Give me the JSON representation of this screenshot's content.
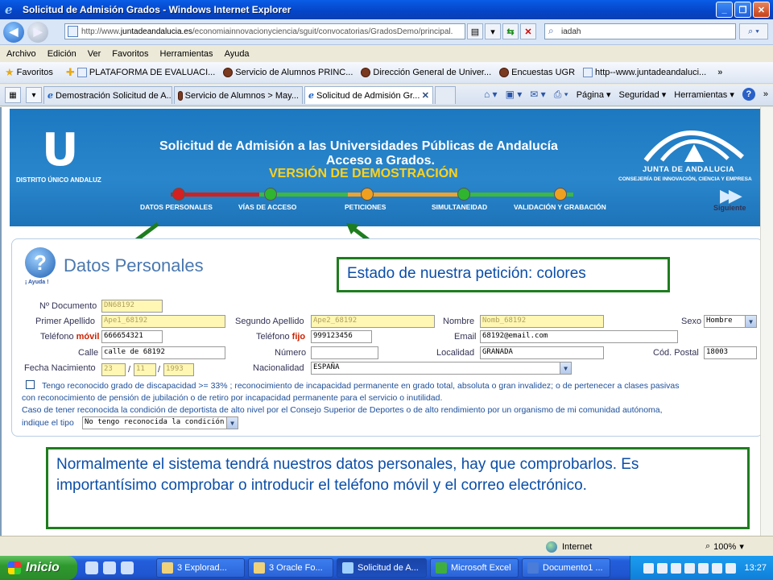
{
  "window": {
    "title": "Solicitud de Admisión Grados - Windows Internet Explorer",
    "minimize": "_",
    "maximize": "❐",
    "close": "✕"
  },
  "address": {
    "url_prefix": "http://www.",
    "url_domain": "juntadeandalucia.es",
    "url_rest": "/economiainnovacionyciencia/sguit/convocatorias/GradosDemo/principal.",
    "search_value": "iadah"
  },
  "menu": [
    "Archivo",
    "Edición",
    "Ver",
    "Favoritos",
    "Herramientas",
    "Ayuda"
  ],
  "favorites": {
    "label": "Favoritos",
    "items": [
      "PLATAFORMA DE EVALUACI...",
      "Servicio de Alumnos PRINC...",
      "Dirección General de Univer...",
      "Encuestas UGR",
      "http--www.juntadeandaluci..."
    ],
    "more": "»"
  },
  "tabs": [
    {
      "label": "Demostración Solicitud de A..."
    },
    {
      "label": "Servicio de Alumnos > May..."
    },
    {
      "label": "Solicitud de Admisión Gr...",
      "active": true
    }
  ],
  "commands": {
    "page": "Página",
    "security": "Seguridad",
    "tools": "Herramientas",
    "more": "»"
  },
  "banner": {
    "logo_letter": "U",
    "logo_text": "DISTRITO ÚNICO ANDALUZ",
    "title_line1": "Solicitud de Admisión a las Universidades Públicas de Andalucía",
    "title_line2": "Acceso a Grados.",
    "title_line3": "VERSIÓN DE DEMOSTRACIÓN",
    "steps": [
      {
        "label": "DATOS PERSONALES",
        "color": "#d42020"
      },
      {
        "label": "VÍAS DE ACCESO",
        "color": "#2fb52f"
      },
      {
        "label": "PETICIONES",
        "color": "#f0a020"
      },
      {
        "label": "SIMULTANEIDAD",
        "color": "#2fb52f"
      },
      {
        "label": "VALIDACIÓN Y GRABACIÓN",
        "color": "#f0a020"
      }
    ],
    "junta_name": "JUNTA DE ANDALUCIA",
    "junta_sub": "CONSEJERÍA DE INNOVACIÓN, CIENCIA Y EMPRESA",
    "next": "Siguiente"
  },
  "form": {
    "title": "Datos Personales",
    "help": "¡ Ayuda !",
    "doc_label": "Nº Documento",
    "doc_value": "DN68192",
    "ape1_label": "Primer Apellido",
    "ape1_value": "Ape1_68192",
    "ape2_label": "Segundo Apellido",
    "ape2_value": "Ape2_68192",
    "nombre_label": "Nombre",
    "nombre_value": "Nomb_68192",
    "sexo_label": "Sexo",
    "sexo_value": "Hombre",
    "tel_label": "Teléfono",
    "tel_movil": "móvil",
    "tel_value": "666654321",
    "tel2_label": "Teléfono",
    "tel2_fijo": "fijo",
    "tel2_value": "999123456",
    "email_label": "Email",
    "email_value": "68192@email.com",
    "calle_label": "Calle",
    "calle_value": "calle de 68192",
    "numero_label": "Número",
    "numero_value": "",
    "localidad_label": "Localidad",
    "localidad_value": "GRANADA",
    "cp_label": "Cód. Postal",
    "cp_value": "18003",
    "fecha_label": "Fecha Nacimiento",
    "fecha_d": "23",
    "fecha_m": "11",
    "fecha_y": "1993",
    "nac_label": "Nacionalidad",
    "nac_value": "ESPAÑA",
    "disc_text1": "Tengo reconocido grado de discapacidad >= 33% ; reconocimiento de incapacidad permanente en grado total, absoluta o gran invalidez; o de pertenecer a clases pasivas",
    "disc_text2": "con reconocimiento de pensión de jubilación o de retiro por incapacidad permanente para el servicio o inutilidad.",
    "dep_text1": "Caso de tener reconocida la condición de deportista de alto nivel por el Consejo Superior de Deportes o de alto rendimiento por un organismo de mi comunidad autónoma,",
    "dep_label": "indique el tipo",
    "dep_value": "No tengo reconocida la condición"
  },
  "callouts": {
    "estado": "Estado de  nuestra petición: colores",
    "normal": "Normalmente el sistema tendrá nuestros datos personales, hay que comprobarlos. Es importantísimo comprobar o introducir el teléfono móvil y el correo electrónico."
  },
  "status": {
    "zone": "Internet",
    "zoom": "100%"
  },
  "taskbar": {
    "start": "Inicio",
    "buttons": [
      "3 Explorad...",
      "3 Oracle Fo...",
      "Solicitud de A...",
      "Microsoft Excel",
      "Documento1 ..."
    ],
    "active_index": 2,
    "clock": "13:27"
  }
}
